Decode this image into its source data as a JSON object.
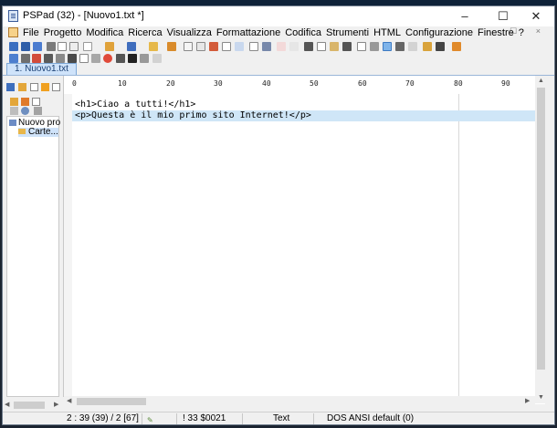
{
  "window": {
    "title": "PSPad (32) - [Nuovo1.txt *]",
    "controls": [
      "–",
      "☐",
      "✕"
    ]
  },
  "menubar": {
    "items": [
      "File",
      "Progetto",
      "Modifica",
      "Ricerca",
      "Visualizza",
      "Formattazione",
      "Codifica",
      "Strumenti",
      "HTML",
      "Configurazione",
      "Finestre",
      "?"
    ],
    "mdi_controls": "- ☐ ×"
  },
  "tabs": [
    {
      "label": "1. Nuovo1.txt",
      "active": true
    }
  ],
  "project_tree": {
    "root": "Nuovo proge",
    "child": "Carte..."
  },
  "ruler": {
    "labels": [
      "0",
      "10",
      "20",
      "30",
      "40",
      "50",
      "60",
      "70",
      "80",
      "90"
    ]
  },
  "editor": {
    "lines": [
      "<h1>Ciao a tutti!</h1>",
      "<p>Questa è il mio primo sito Internet!</p>"
    ],
    "current_line": 2
  },
  "statusbar": {
    "position": "2 : 39 (39) / 2  [67]",
    "char_info": "!  33  $0021",
    "mode": "Text",
    "encoding": "DOS  ANSI default (0)"
  },
  "colors": {
    "current_line": "#cfe6f7",
    "tab_active": "#cfe3fa",
    "title_bg": "#ffffff",
    "chrome": "#f0f0f0"
  }
}
